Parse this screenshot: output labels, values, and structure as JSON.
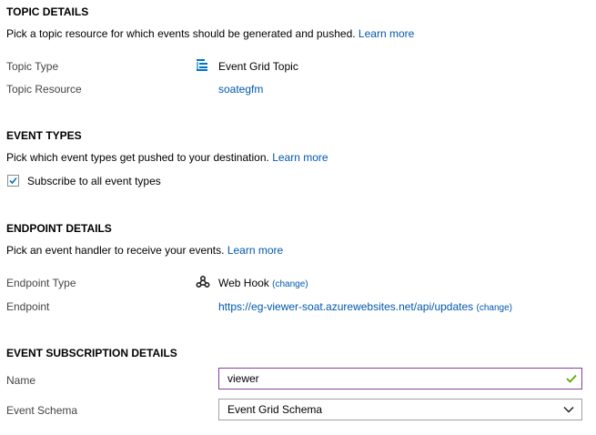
{
  "topic": {
    "heading": "TOPIC DETAILS",
    "description": "Pick a topic resource for which events should be generated and pushed.",
    "learn_more": "Learn more",
    "type_label": "Topic Type",
    "type_value": "Event Grid Topic",
    "type_icon": "event-grid-topic-icon",
    "resource_label": "Topic Resource",
    "resource_value": "soategfm"
  },
  "event_types": {
    "heading": "EVENT TYPES",
    "description": "Pick which event types get pushed to your destination.",
    "learn_more": "Learn more",
    "subscribe_all_label": "Subscribe to all event types",
    "subscribe_all_checked": true
  },
  "endpoint": {
    "heading": "ENDPOINT DETAILS",
    "description": "Pick an event handler to receive your events.",
    "learn_more": "Learn more",
    "type_label": "Endpoint Type",
    "type_value": "Web Hook",
    "type_icon": "webhook-icon",
    "type_change": "(change)",
    "endpoint_label": "Endpoint",
    "endpoint_value": "https://eg-viewer-soat.azurewebsites.net/api/updates",
    "endpoint_change": "(change)"
  },
  "subscription": {
    "heading": "EVENT SUBSCRIPTION DETAILS",
    "name_label": "Name",
    "name_value": "viewer",
    "schema_label": "Event Schema",
    "schema_value": "Event Grid Schema"
  },
  "colors": {
    "link": "#0058ad",
    "input_focus_border": "#8a3fa0",
    "valid_check": "#5ea700"
  }
}
